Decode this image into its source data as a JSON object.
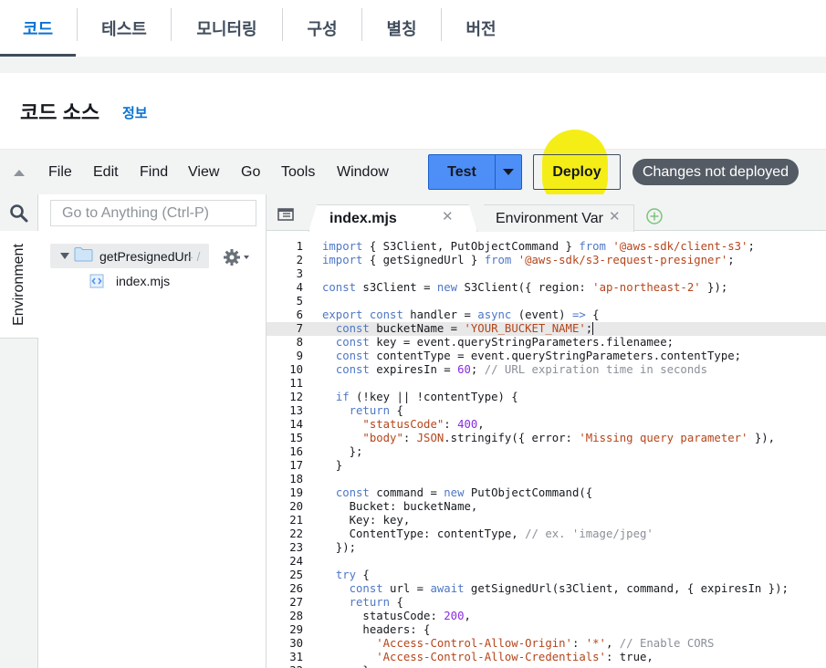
{
  "tabs": [
    {
      "label": "코드"
    },
    {
      "label": "테스트"
    },
    {
      "label": "모니터링"
    },
    {
      "label": "구성"
    },
    {
      "label": "별칭"
    },
    {
      "label": "버전"
    }
  ],
  "section": {
    "title": "코드 소스",
    "info_link": "정보"
  },
  "menu": [
    "File",
    "Edit",
    "Find",
    "View",
    "Go",
    "Tools",
    "Window"
  ],
  "buttons": {
    "test": "Test",
    "deploy": "Deploy"
  },
  "status_badge": "Changes not deployed",
  "sidebar": {
    "panel_label": "Environment",
    "search_placeholder": "Go to Anything (Ctrl-P)",
    "folder": "getPresignedUrl",
    "folder_suffix": "- /",
    "file": "index.mjs"
  },
  "editor_tabs": [
    {
      "label": "index.mjs",
      "active": true
    },
    {
      "label": "Environment Var",
      "active": false
    }
  ],
  "icons": {
    "collapse": "triangle-up-icon",
    "search": "search-icon",
    "folder": "folder-icon",
    "settings": "gear-icon",
    "file": "js-file-icon",
    "tab_menu": "tab-menu-icon",
    "add_tab": "plus-circle-icon",
    "close": "close-icon"
  },
  "colors": {
    "accent": "#0972d3",
    "test_button": "#4e8ef7",
    "badge": "#545b64",
    "highlight": "#f5ee16"
  },
  "code": {
    "active_line": 7,
    "lines": [
      "import { S3Client, PutObjectCommand } from '@aws-sdk/client-s3';",
      "import { getSignedUrl } from '@aws-sdk/s3-request-presigner';",
      "",
      "const s3Client = new S3Client({ region: 'ap-northeast-2' });",
      "",
      "export const handler = async (event) => {",
      "  const bucketName = 'YOUR_BUCKET_NAME';",
      "  const key = event.queryStringParameters.filenamee;",
      "  const contentType = event.queryStringParameters.contentType;",
      "  const expiresIn = 60; // URL expiration time in seconds",
      "",
      "  if (!key || !contentType) {",
      "    return {",
      "      \"statusCode\": 400,",
      "      \"body\": JSON.stringify({ error: 'Missing query parameter' }),",
      "    };",
      "  }",
      "",
      "  const command = new PutObjectCommand({",
      "    Bucket: bucketName,",
      "    Key: key,",
      "    ContentType: contentType, // ex. 'image/jpeg'",
      "  });",
      "",
      "  try {",
      "    const url = await getSignedUrl(s3Client, command, { expiresIn });",
      "    return {",
      "      statusCode: 200,",
      "      headers: {",
      "        'Access-Control-Allow-Origin': '*', // Enable CORS",
      "        'Access-Control-Allow-Credentials': true,",
      "      },"
    ]
  }
}
